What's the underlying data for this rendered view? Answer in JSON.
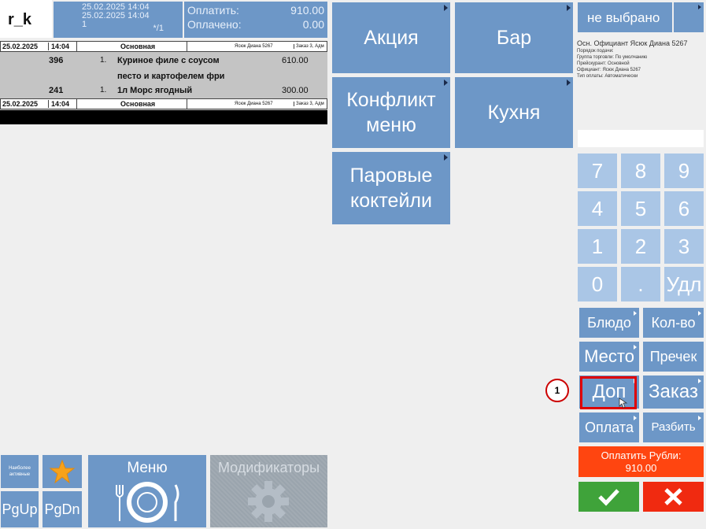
{
  "header": {
    "logo": "r_k",
    "date1": "25.02.2025 14:04",
    "date2": "25.02.2025 14:04",
    "guests": "1",
    "page": "*/1",
    "pay_label": "Оплатить:",
    "pay_value": "910.00",
    "paid_label": "Оплачено:",
    "paid_value": "0.00"
  },
  "order": {
    "head1": {
      "date": "25.02.2025",
      "time": "14:04",
      "type": "Основная",
      "waiter": "Ясюк Диана 5267",
      "extra": "Заказ 3, Адм"
    },
    "items": [
      {
        "code": "396",
        "qty": "1.",
        "name_line1": "Куриное филе с соусом",
        "name_line2": "песто и картофелем фри",
        "price": "610.00"
      },
      {
        "code": "241",
        "qty": "1.",
        "name_line1": "1л Морс ягодный",
        "name_line2": "",
        "price": "300.00"
      }
    ],
    "head2": {
      "date": "25.02.2025",
      "time": "14:04",
      "type": "Основная",
      "waiter": "Ясюк Диана 5267",
      "extra": "Заказ 3, Адм"
    }
  },
  "categories": {
    "c1": "Акция",
    "c2": "Бар",
    "c3_line1": "Конфликт",
    "c3_line2": "меню",
    "c4": "Кухня",
    "c5_line1": "Паровые",
    "c5_line2": "коктейли"
  },
  "info": {
    "not_selected": "не выбрано",
    "lines": [
      "Осн. Официант   Ясюк Диана 5267",
      "Порядок подачи:",
      "Группа торговли: По умолчанию",
      "Прейскурант: Основной",
      "Официант: Ясюк Диана 5267",
      "Тип оплаты: Автоматически"
    ]
  },
  "keypad": [
    "7",
    "8",
    "9",
    "4",
    "5",
    "6",
    "1",
    "2",
    "3",
    "0",
    ".",
    "Удл"
  ],
  "functions": {
    "dish": "Блюдо",
    "qty": "Кол-во",
    "place": "Место",
    "precheck": "Пречек",
    "extra": "Доп",
    "order": "Заказ",
    "payment": "Оплата",
    "split": "Разбить"
  },
  "pay_rub_label": "Оплатить Рубли:",
  "pay_rub_value": "910.00",
  "callout_number": "1",
  "bottom": {
    "popular": "Наиболее\nактивные",
    "pgup": "PgUp",
    "pgdn": "PgDn",
    "menu": "Меню",
    "modifiers": "Модификаторы"
  },
  "colors": {
    "accent_blue": "#6d97c7",
    "key_light_blue": "#aac6e6",
    "pay_orange": "#ff4510",
    "ok_green": "#3fa33a",
    "cancel_red": "#f02a10",
    "highlight_red": "#e00000"
  }
}
